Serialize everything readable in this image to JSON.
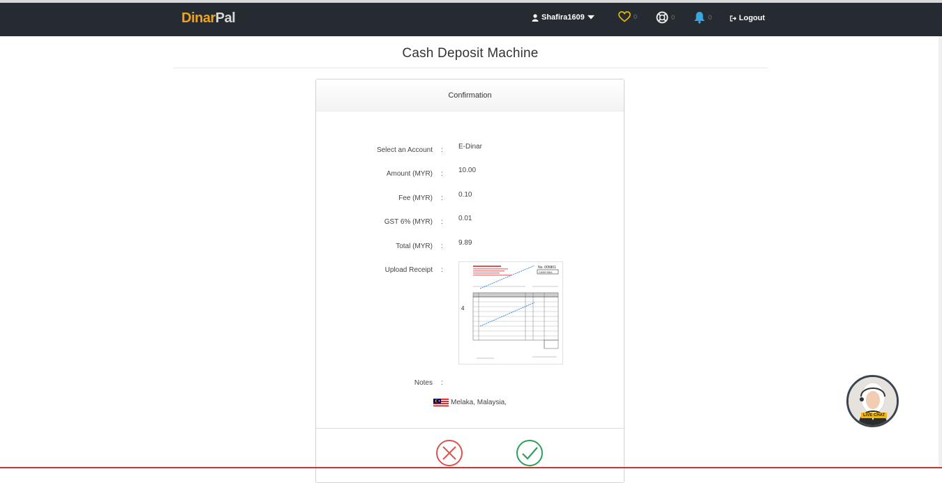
{
  "brand": {
    "part1": "Dinar",
    "part2": "Pal"
  },
  "nav": {
    "username": "Shafira1609",
    "favorites_count": "0",
    "support_count": "0",
    "notifications_count": "0",
    "logout_label": "Logout"
  },
  "page": {
    "title": "Cash Deposit Machine"
  },
  "panel": {
    "heading": "Confirmation",
    "fields": [
      {
        "label": "Select an Account",
        "value": "E-Dinar"
      },
      {
        "label": "Amount (MYR)",
        "value": "10.00"
      },
      {
        "label": "Fee (MYR)",
        "value": "0.10"
      },
      {
        "label": "GST 6% (MYR)",
        "value": "0.01"
      },
      {
        "label": "Total (MYR)",
        "value": "9.89"
      },
      {
        "label": "Upload Receipt",
        "value": ""
      },
      {
        "label": "Notes",
        "value": ""
      }
    ],
    "colon": ":",
    "receipt_number": "4",
    "receipt_title": "CASH BILL",
    "receipt_no": "No. 005801",
    "location": "Melaka, Malaysia,"
  },
  "live_chat": {
    "label": "LIVE CHAT"
  },
  "colors": {
    "brand_orange": "#f0a21c",
    "topbar": "#262b31",
    "cancel_red": "#d9534f",
    "confirm_green": "#2aa05a",
    "bell_blue": "#3aa6e0",
    "heart_yellow": "#e6b800"
  },
  "icons": [
    "user-icon",
    "caret-down-icon",
    "heart-icon",
    "lifebuoy-icon",
    "bell-icon",
    "logout-icon",
    "cancel-icon",
    "confirm-icon",
    "malaysia-flag-icon"
  ]
}
